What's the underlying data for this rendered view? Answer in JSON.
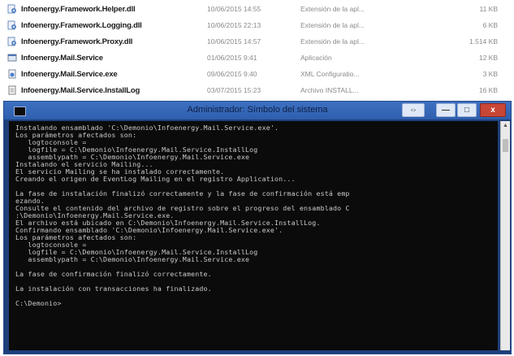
{
  "files": [
    {
      "icon": "dll-file-icon",
      "name": "Infoenergy.Framework.Helper.dll",
      "date": "10/06/2015 14:55",
      "type": "Extensión de la apl...",
      "size": "11 KB"
    },
    {
      "icon": "dll-file-icon",
      "name": "Infoenergy.Framework.Logging.dll",
      "date": "10/06/2015 22:13",
      "type": "Extensión de la apl...",
      "size": "6 KB"
    },
    {
      "icon": "dll-file-icon",
      "name": "Infoenergy.Framework.Proxy.dll",
      "date": "10/06/2015 14:57",
      "type": "Extensión de la apl...",
      "size": "1.514 KB"
    },
    {
      "icon": "application-file-icon",
      "name": "Infoenergy.Mail.Service",
      "date": "01/06/2015 9:41",
      "type": "Aplicación",
      "size": "12 KB"
    },
    {
      "icon": "config-file-icon",
      "name": "Infoenergy.Mail.Service.exe",
      "date": "09/06/2015 9:40",
      "type": "XML Configuratio...",
      "size": "3 KB"
    },
    {
      "icon": "log-file-icon",
      "name": "Infoenergy.Mail.Service.InstallLog",
      "date": "03/07/2015 15:23",
      "type": "Archivo INSTALL...",
      "size": "16 KB"
    }
  ],
  "console": {
    "title": "Administrador: Símbolo del sistema",
    "buttons": {
      "extra": "⇔",
      "minimize": "—",
      "maximize": "□",
      "close": "x"
    },
    "lines": [
      "Instalando ensamblado 'C:\\Demonio\\Infoenergy.Mail.Service.exe'.",
      "Los parámetros afectados son:",
      "   logtoconsole =",
      "   logfile = C:\\Demonio\\Infoenergy.Mail.Service.InstallLog",
      "   assemblypath = C:\\Demonio\\Infoenergy.Mail.Service.exe",
      "Instalando el servicio Mailing...",
      "El servicio Mailing se ha instalado correctamente.",
      "Creando el origen de EventLog Mailing en el registro Application...",
      "",
      "La fase de instalación finalizó correctamente y la fase de confirmación está emp",
      "ezando.",
      "Consulte el contenido del archivo de registro sobre el progreso del ensamblado C",
      ":\\Demonio\\Infoenergy.Mail.Service.exe.",
      "El archivo está ubicado en C:\\Demonio\\Infoenergy.Mail.Service.InstallLog.",
      "Confirmando ensamblado 'C:\\Demonio\\Infoenergy.Mail.Service.exe'.",
      "Los parámetros afectados son:",
      "   logtoconsole =",
      "   logfile = C:\\Demonio\\Infoenergy.Mail.Service.InstallLog",
      "   assemblypath = C:\\Demonio\\Infoenergy.Mail.Service.exe",
      "",
      "La fase de confirmación finalizó correctamente.",
      "",
      "La instalación con transacciones ha finalizado.",
      "",
      "C:\\Demonio>"
    ]
  },
  "colors": {
    "console_background": "#0b0b0b",
    "console_text": "#c9c9c9",
    "titlebar": "#3d70c2",
    "close_button": "#c84636"
  }
}
